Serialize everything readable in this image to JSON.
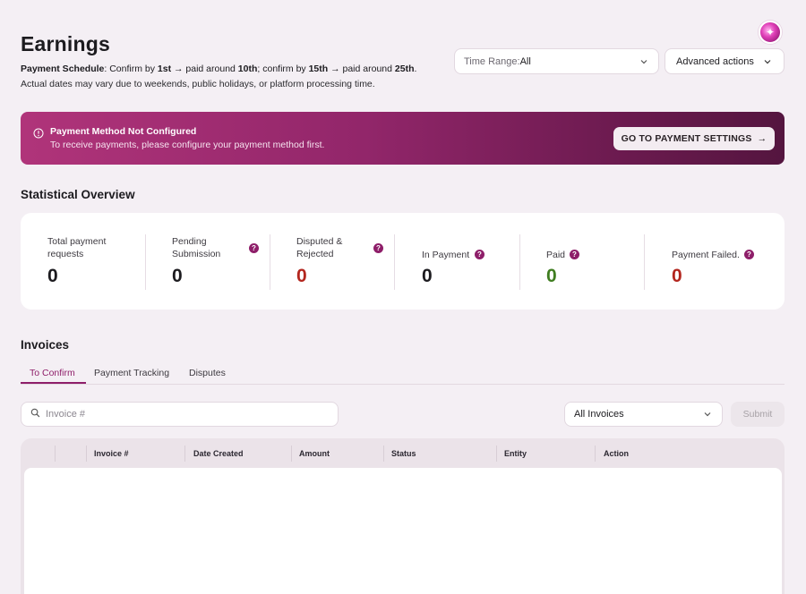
{
  "header": {
    "title": "Earnings",
    "schedule": {
      "label": "Payment Schedule",
      "part1": ": Confirm by ",
      "b1": "1st",
      "part2": " → paid around ",
      "b2": "10th",
      "part3": "; confirm by ",
      "b3": "15th",
      "part4": " → paid around ",
      "b4": "25th",
      "part5": "."
    },
    "note": "Actual dates may vary due to weekends, public holidays, or platform processing time.",
    "time_range_label": "Time Range:",
    "time_range_value": "All",
    "advanced_actions": "Advanced actions"
  },
  "banner": {
    "title": "Payment Method Not Configured",
    "subtitle": "To receive payments, please configure your payment method first.",
    "button": "GO TO PAYMENT SETTINGS",
    "button_arrow": "→"
  },
  "stats": {
    "title": "Statistical Overview",
    "items": [
      {
        "label": "Total payment requests",
        "value": "0",
        "color": "#1c1b1f"
      },
      {
        "label": "Pending Submission",
        "value": "0",
        "color": "#1c1b1f"
      },
      {
        "label": "Disputed & Rejected",
        "value": "0",
        "color": "#b3261e"
      },
      {
        "label": "In Payment",
        "value": "0",
        "color": "#1c1b1f"
      },
      {
        "label": "Paid",
        "value": "0",
        "color": "#3f7d20"
      },
      {
        "label": "Payment Failed.",
        "value": "0",
        "color": "#b3261e"
      }
    ],
    "help_glyph": "?"
  },
  "invoices": {
    "title": "Invoices",
    "tabs": [
      "To Confirm",
      "Payment Tracking",
      "Disputes"
    ],
    "active_tab": "To Confirm",
    "search_placeholder": "Invoice #",
    "filter_value": "All Invoices",
    "submit_label": "Submit",
    "columns": [
      "Invoice #",
      "Date Created",
      "Amount",
      "Status",
      "Entity",
      "Action"
    ]
  },
  "colors": {
    "accent": "#8e1e69",
    "banner_start": "#b0347a",
    "banner_end": "#54153f",
    "background": "#f4eff4"
  },
  "icons": [
    "avatar",
    "chevron-down-icon",
    "info-icon",
    "arrow-right-icon",
    "help-icon",
    "search-icon"
  ]
}
